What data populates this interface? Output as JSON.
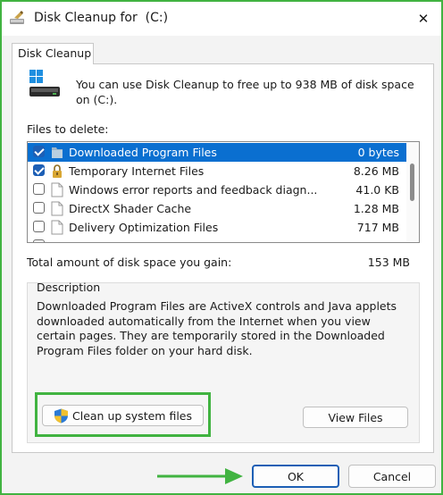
{
  "window": {
    "title": "Disk Cleanup for  (C:)",
    "close_glyph": "✕",
    "title_icon": "disk-cleanup-icon"
  },
  "tab": {
    "label": "Disk Cleanup"
  },
  "intro": {
    "text": "You can use Disk Cleanup to free up to 938 MB of disk space on (C:).",
    "icon": "drive-icon"
  },
  "files": {
    "label": "Files to delete:",
    "items": [
      {
        "name": "Downloaded Program Files",
        "size": "0 bytes",
        "checked": true,
        "selected": true,
        "icon": "folder-icon"
      },
      {
        "name": "Temporary Internet Files",
        "size": "8.26 MB",
        "checked": true,
        "selected": false,
        "icon": "lock-icon"
      },
      {
        "name": "Windows error reports and feedback diagn...",
        "size": "41.0 KB",
        "checked": false,
        "selected": false,
        "icon": "file-icon"
      },
      {
        "name": "DirectX Shader Cache",
        "size": "1.28 MB",
        "checked": false,
        "selected": false,
        "icon": "file-icon"
      },
      {
        "name": "Delivery Optimization Files",
        "size": "717 MB",
        "checked": false,
        "selected": false,
        "icon": "file-icon"
      }
    ]
  },
  "total": {
    "label": "Total amount of disk space you gain:",
    "value": "153 MB"
  },
  "description": {
    "label": "Description",
    "text": "Downloaded Program Files are ActiveX controls and Java applets downloaded automatically from the Internet when you view certain pages. They are temporarily stored in the Downloaded Program Files folder on your hard disk."
  },
  "buttons": {
    "cleanup_system": "Clean up system files",
    "view_files": "View Files",
    "ok": "OK",
    "cancel": "Cancel"
  },
  "colors": {
    "highlight": "#41b341",
    "selection": "#0a6fd0",
    "accent": "#1d5fb5"
  }
}
